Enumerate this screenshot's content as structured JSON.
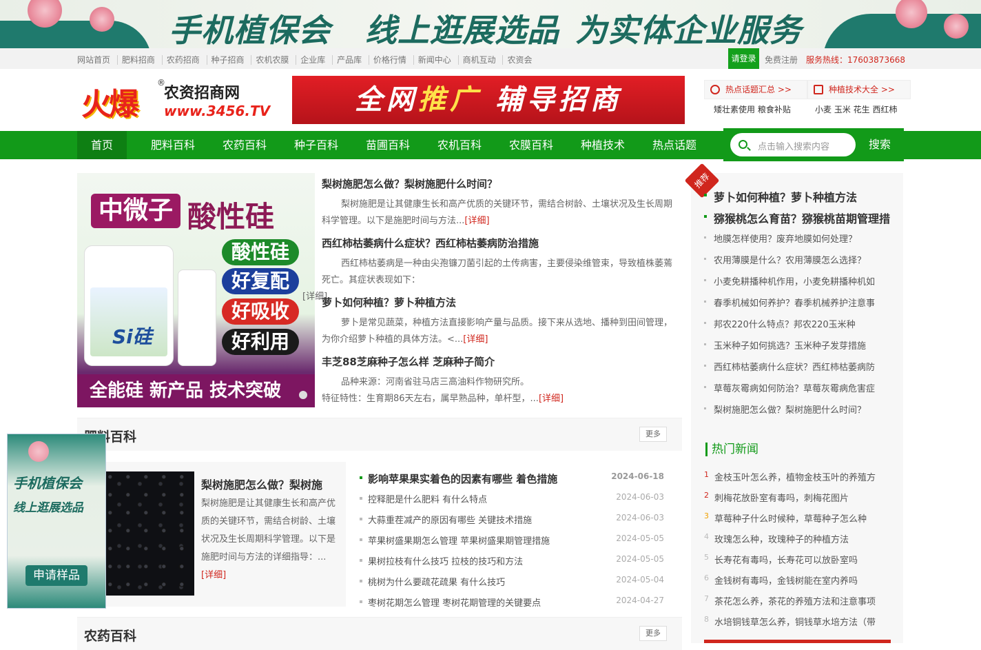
{
  "top_banner": {
    "slogan_1": "手机植保会",
    "slogan_2": "线上逛展选品",
    "slogan_3": "为实体企业服务"
  },
  "top_nav": {
    "links": [
      "网站首页",
      "肥料招商",
      "农药招商",
      "种子招商",
      "农机农膜",
      "企业库",
      "产品库",
      "价格行情",
      "新闻中心",
      "商机互动",
      "农资会"
    ],
    "login": "请登录",
    "register": "免费注册",
    "hotline": "服务热线：17603873668"
  },
  "logo": {
    "mark": "火爆",
    "reg": "®",
    "name": "农资招商网",
    "url": "www.3456.TV"
  },
  "ad_banner": {
    "text_a": "全网",
    "text_b": "推广",
    "text_c": "辅导招商"
  },
  "header_boxes": [
    {
      "label": "热点话题汇总 >>",
      "sub": "矮壮素使用 粮食补贴",
      "icon": "fire-icon"
    },
    {
      "label": "种植技术大全 >>",
      "sub": "小麦 玉米 花生 西红柿",
      "icon": "book-icon"
    }
  ],
  "main_nav": {
    "items": [
      "首页",
      "肥料百科",
      "农药百科",
      "种子百科",
      "苗圃百科",
      "农机百科",
      "农膜百科",
      "种植技术",
      "热点话题"
    ],
    "search_placeholder": "点击输入搜索内容",
    "search_button": "搜索"
  },
  "featured": {
    "tag": "中微子",
    "title": "酸性硅",
    "pills": [
      "酸性硅",
      "好复配",
      "好吸收",
      "好利用"
    ],
    "bottom": "全能硅 新产品 技术突破",
    "product_label": "Si硅"
  },
  "articles": [
    {
      "title": "梨树施肥怎么做？梨树施肥什么时间？",
      "summary": "梨树施肥是让其健康生长和高产优质的关键环节，需结合树龄、土壤状况及生长周期科学管理。以下是施肥时间与方法...",
      "more": "[详细]"
    },
    {
      "title": "西红柿枯萎病什么症状？西红柿枯萎病防治措施",
      "summary": "西红柿枯萎病是一种由尖孢镰刀菌引起的土传病害，主要侵染维管束，导致植株萎蔫死亡。其症状表现如下：",
      "more": "[详细]"
    },
    {
      "title": "萝卜如何种植？萝卜种植方法",
      "summary": "萝卜是常见蔬菜，种植方法直接影响产量与品质。接下来从选地、播种到田间管理，为你介绍萝卜种植的具体方法。<...",
      "more": "[详细]"
    },
    {
      "title": "丰芝88芝麻种子怎么样 芝麻种子简介",
      "line1": "品种来源：河南省驻马店三高油料作物研究所。",
      "line2": "特征特性：生育期86天左右，属早熟品种，单杆型，...",
      "more": "[详细]"
    }
  ],
  "section_fertilizer": {
    "title": "肥料百科",
    "more": "更多",
    "feature_title": "梨树施肥怎么做？梨树施",
    "feature_summary": "梨树施肥是让其健康生长和高产优质的关键环节，需结合树龄、土壤状况及生长周期科学管理。以下是施肥时间与方法的详细指导：...",
    "feature_more": "[详细]",
    "news": [
      {
        "title": "影响苹果果实着色的因素有哪些 着色措施",
        "date": "2024-06-18"
      },
      {
        "title": "控释肥是什么肥料 有什么特点",
        "date": "2024-06-03"
      },
      {
        "title": "大蒜重茬减产的原因有哪些 关键技术措施",
        "date": "2024-06-03"
      },
      {
        "title": "苹果树盛果期怎么管理 苹果树盛果期管理措施",
        "date": "2024-05-05"
      },
      {
        "title": "果树拉枝有什么技巧 拉枝的技巧和方法",
        "date": "2024-05-05"
      },
      {
        "title": "桃树为什么要疏花疏果 有什么技巧",
        "date": "2024-05-04"
      },
      {
        "title": "枣树花期怎么管理 枣树花期管理的关键要点",
        "date": "2024-04-27"
      }
    ]
  },
  "section_pesticide": {
    "title": "农药百科",
    "more": "更多"
  },
  "float_ad": {
    "line1": "手机植保会",
    "line2": "线上逛展选品",
    "button": "申请样品"
  },
  "recommend": {
    "tag": "推荐",
    "items": [
      "萝卜如何种植？萝卜种植方法",
      "猕猴桃怎么育苗？猕猴桃苗期管理措",
      "地膜怎样使用？废弃地膜如何处理？",
      "农用薄膜是什么？农用薄膜怎么选择？",
      "小麦免耕播种机作用，小麦免耕播种机如",
      "春季机械如何养护？春季机械养护注意事",
      "邦农220什么特点？邦农220玉米种",
      "玉米种子如何挑选？玉米种子发芽措施",
      "西红柿枯萎病什么症状？西红柿枯萎病防",
      "草莓灰霉病如何防治？草莓灰霉病危害症",
      "梨树施肥怎么做？梨树施肥什么时间？"
    ]
  },
  "hot_news": {
    "title": "热门新闻",
    "items": [
      {
        "num": "1",
        "title": "金枝玉叶怎么养，植物金枝玉叶的养殖方",
        "color": "#d0261d"
      },
      {
        "num": "2",
        "title": "刺梅花放卧室有毒吗，刺梅花图片",
        "color": "#d0261d"
      },
      {
        "num": "3",
        "title": "草莓种子什么时候种，草莓种子怎么种",
        "color": "#f0a000"
      },
      {
        "num": "4",
        "title": "玫瑰怎么种，玫瑰种子的种植方法",
        "color": "#bbbbbb"
      },
      {
        "num": "5",
        "title": "长寿花有毒吗，长寿花可以放卧室吗",
        "color": "#bbbbbb"
      },
      {
        "num": "6",
        "title": "金钱树有毒吗，金钱树能在室内养吗",
        "color": "#bbbbbb"
      },
      {
        "num": "7",
        "title": "茶花怎么养，茶花的养殖方法和注意事项",
        "color": "#bbbbbb"
      },
      {
        "num": "8",
        "title": "水培铜钱草怎么养，铜钱草水培方法（带",
        "color": "#bbbbbb"
      }
    ]
  },
  "colors": {
    "brand_green": "#129a19",
    "accent_red": "#d0261d",
    "dark_green": "#1f7a6d"
  }
}
